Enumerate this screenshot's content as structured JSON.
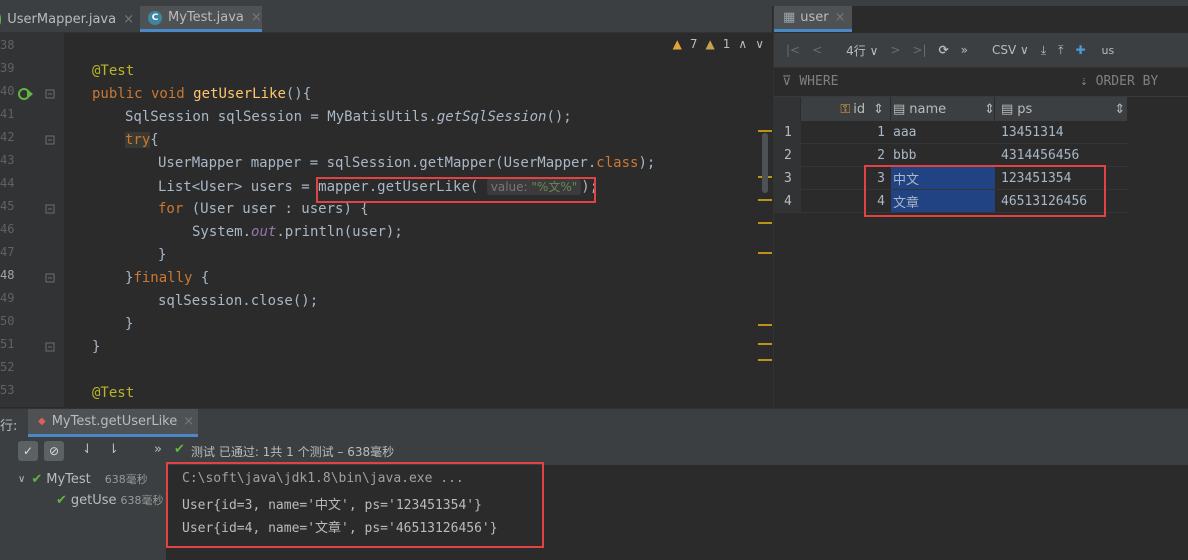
{
  "editor_tabs": [
    {
      "label": "UserMapper.java",
      "close": "×"
    },
    {
      "label": "MyTest.java",
      "close": "×"
    }
  ],
  "inspections": {
    "warnings": "7",
    "weak_warnings": "1"
  },
  "gutter_numbers": [
    "38",
    "39",
    "40",
    "41",
    "42",
    "43",
    "44",
    "45",
    "46",
    "47",
    "48",
    "49",
    "50",
    "51",
    "52",
    "53"
  ],
  "code": {
    "l1_ann": "@Test",
    "l2_kw": "public void ",
    "l2_fn": "getUserLike",
    "l2_rest": "(){",
    "l3_type": "SqlSession sqlSession = ",
    "l3_static": "MyBatisUtils.",
    "l3_method": "getSqlSession",
    "l3_end": "();",
    "l4_kw": "try",
    "l4_end": "{",
    "l5_a": "UserMapper mapper = sqlSession.getMapper(UserMapper.",
    "l5_kw": "class",
    "l5_end": ");",
    "l6_a": "List<User> users = ",
    "l6_b": "mapper.getUserLike(",
    "l6_hint": "value:",
    "l6_str": "\"%文%\"",
    "l6_end": ");",
    "l7_kw": "for",
    "l7_rest": " (User user : users) {",
    "l8_a": "System.",
    "l8_field": "out",
    "l8_b": ".println(user);",
    "l9": "}",
    "l10_a": "}",
    "l10_kw": "finally",
    "l10_b": " {",
    "l11": "sqlSession.close();",
    "l12": "}",
    "l13": "}",
    "l15_ann": "@Test"
  },
  "db": {
    "tab_label": "user",
    "rows_label": "4行",
    "export_label": "CSV",
    "extra_label": "us",
    "where_label": "WHERE",
    "order_label": "ORDER BY",
    "columns": [
      "id",
      "name",
      "ps"
    ],
    "rows": [
      {
        "n": "1",
        "id": "1",
        "name": "aaa",
        "ps": "13451314"
      },
      {
        "n": "2",
        "id": "2",
        "name": "bbb",
        "ps": "4314456456"
      },
      {
        "n": "3",
        "id": "3",
        "name": "中文",
        "ps": "123451354"
      },
      {
        "n": "4",
        "id": "4",
        "name": "文章",
        "ps": "46513126456"
      }
    ]
  },
  "run": {
    "prefix": "行:",
    "config_label": "MyTest.getUserLike",
    "status": "测试 已通过: 1共 1 个测试 – 638毫秒",
    "tree_root": "MyTest",
    "tree_root_time": "638毫秒",
    "tree_child": "getUse",
    "tree_child_time": "638毫秒"
  },
  "console": {
    "line1": "C:\\soft\\java\\jdk1.8\\bin\\java.exe ...",
    "line2": "User{id=3, name='中文', ps='123451354'}",
    "line3": "User{id=4, name='文章', ps='46513126456'}"
  },
  "colors": {
    "accent": "#4a88c7",
    "highlight_box": "#e04343",
    "selection": "#214283",
    "pass": "#62b543"
  }
}
